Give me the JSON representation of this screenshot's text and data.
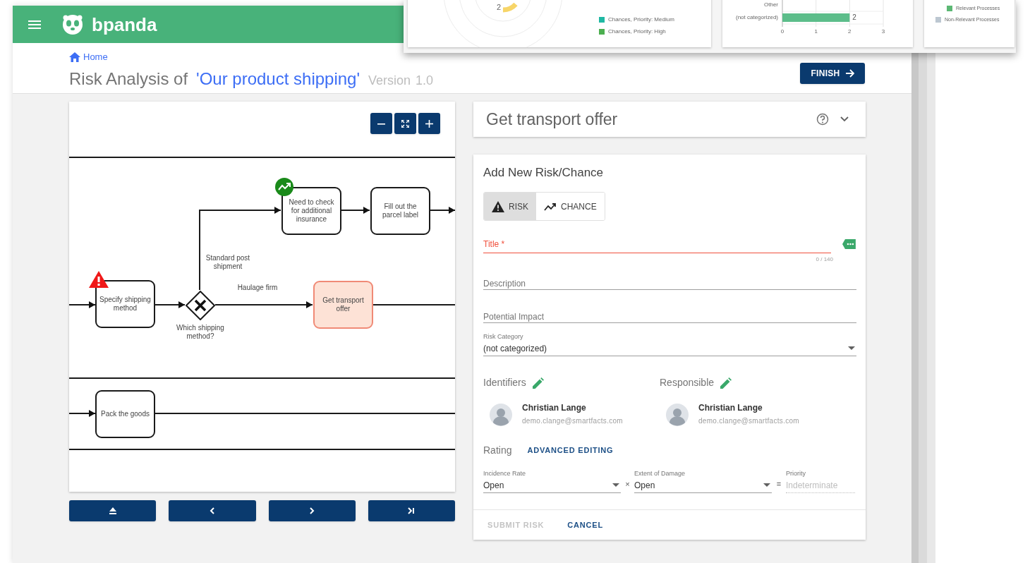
{
  "app_bar": {
    "brand": "bpanda"
  },
  "breadcrumb": {
    "label": "Home"
  },
  "page_title": {
    "prefix": "Risk Analysis of",
    "process": "'Our product shipping'",
    "version_label": "Version",
    "version": "1.0"
  },
  "finish_button": {
    "label": "FINISH"
  },
  "diagram": {
    "nodes": [
      {
        "kind": "task",
        "label": "Specify shipping method",
        "has_risk": true,
        "has_chance": false,
        "selected": false
      },
      {
        "kind": "gateway",
        "label": "Which shipping method?"
      },
      {
        "kind": "task",
        "label": "Need to check for additional insurance",
        "has_risk": false,
        "has_chance": true,
        "selected": false
      },
      {
        "kind": "task",
        "label": "Fill out the parcel label",
        "has_risk": false,
        "has_chance": false,
        "selected": false
      },
      {
        "kind": "task",
        "label": "Get transport offer",
        "has_risk": false,
        "has_chance": false,
        "selected": true
      },
      {
        "kind": "task",
        "label": "Pack the goods",
        "has_risk": false,
        "has_chance": false,
        "selected": false
      }
    ],
    "flow_labels": [
      "Standard post shipment",
      "Haulage firm"
    ]
  },
  "detail_header": {
    "title": "Get transport offer"
  },
  "form": {
    "heading": "Add New Risk/Chance",
    "types": [
      {
        "kind": "risk",
        "label": "RISK",
        "selected": true
      },
      {
        "kind": "chance",
        "label": "CHANCE",
        "selected": false
      }
    ],
    "title_field": {
      "label": "Title *",
      "counter": "0 / 140",
      "invalid": true
    },
    "description": {
      "placeholder": "Description"
    },
    "impact": {
      "placeholder": "Potential Impact"
    },
    "risk_category": {
      "label": "Risk Category",
      "value": "(not categorized)"
    },
    "identifiers": {
      "label": "Identifiers",
      "people": [
        {
          "name": "Christian Lange",
          "email": "demo.clange@smartfacts.com"
        }
      ]
    },
    "responsible": {
      "label": "Responsible",
      "people": [
        {
          "name": "Christian Lange",
          "email": "demo.clange@smartfacts.com"
        }
      ]
    },
    "rating": {
      "label": "Rating",
      "advanced_link": "ADVANCED EDITING",
      "incidence": {
        "label": "Incidence Rate",
        "value": "Open"
      },
      "times": "×",
      "damage": {
        "label": "Extent of Damage",
        "value": "Open"
      },
      "equals": "=",
      "priority": {
        "label": "Priority",
        "placeholder": "Indeterminate",
        "disabled": true
      }
    },
    "actions": [
      {
        "label": "SUBMIT RISK",
        "disabled": true
      },
      {
        "label": "CANCEL",
        "disabled": false
      }
    ]
  },
  "dashboard_overlay": {
    "gauge_label": "2",
    "legend": [
      {
        "label": "Chances, Priority: Medium",
        "color": "#1fb8a3"
      },
      {
        "label": "Chances, Priority: High",
        "color": "#4caf50"
      }
    ],
    "chart_data": {
      "type": "bar",
      "orientation": "horizontal",
      "categories": [
        "Other",
        "(not categorized)"
      ],
      "values": [
        0,
        2
      ],
      "xlim": [
        0,
        3
      ],
      "xticks": [
        0,
        1,
        2,
        3
      ],
      "value_labels": [
        null,
        "2"
      ]
    },
    "process_legend": [
      {
        "label": "Relevant Processes",
        "color": "#5cb874"
      },
      {
        "label": "Non-Relevant Processes",
        "color": "#bcc7d1"
      }
    ]
  }
}
